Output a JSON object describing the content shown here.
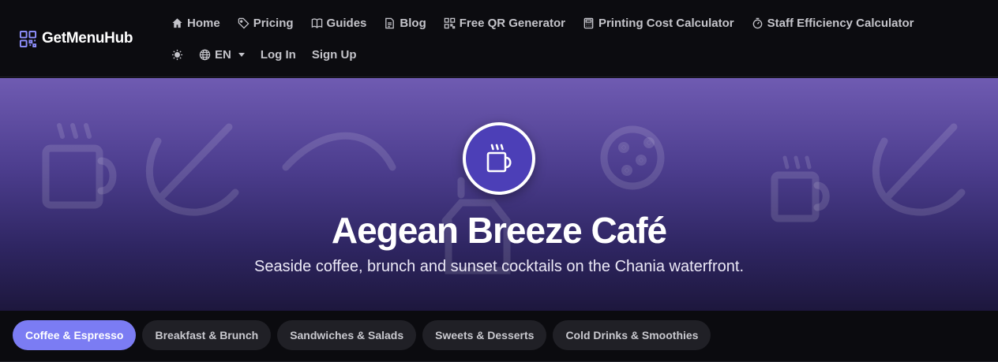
{
  "brand": {
    "name": "GetMenuHub",
    "icon": "qr-code-icon"
  },
  "nav": {
    "primary": [
      {
        "label": "Home",
        "icon": "home-icon"
      },
      {
        "label": "Pricing",
        "icon": "tag-icon"
      },
      {
        "label": "Guides",
        "icon": "book-icon"
      },
      {
        "label": "Blog",
        "icon": "document-icon"
      },
      {
        "label": "Free QR Generator",
        "icon": "qr-code-icon"
      },
      {
        "label": "Printing Cost Calculator",
        "icon": "calculator-icon"
      },
      {
        "label": "Staff Efficiency Calculator",
        "icon": "stopwatch-icon"
      }
    ],
    "secondary": {
      "theme_icon": "sun-icon",
      "language": {
        "label": "EN",
        "icon": "globe-icon"
      },
      "login_label": "Log In",
      "signup_label": "Sign Up"
    }
  },
  "hero": {
    "badge_icon": "coffee-cup-icon",
    "title": "Aegean Breeze Café",
    "subtitle": "Seaside coffee, brunch and sunset cocktails on the Chania waterfront.",
    "colors": {
      "gradient_top": "#6f5bb2",
      "gradient_bottom": "#1d173d",
      "badge": "#4c3fb7"
    }
  },
  "categories": {
    "active_index": 0,
    "accent": "#7b7cf3",
    "items": [
      {
        "label": "Coffee & Espresso"
      },
      {
        "label": "Breakfast & Brunch"
      },
      {
        "label": "Sandwiches & Salads"
      },
      {
        "label": "Sweets & Desserts"
      },
      {
        "label": "Cold Drinks & Smoothies"
      }
    ]
  }
}
